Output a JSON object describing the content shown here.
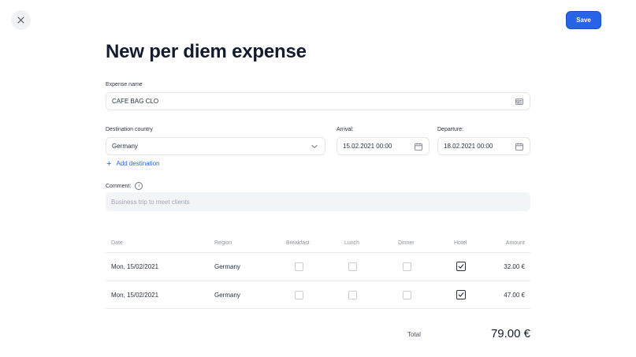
{
  "header": {
    "close_icon": "close-icon",
    "save_label": "Save"
  },
  "title": "New per diem expense",
  "expense_name": {
    "label": "Expense name",
    "value": "CAFE BAG CLO",
    "icon": "id-card-icon"
  },
  "destination": {
    "label": "Destination country",
    "value": "Germany",
    "icon": "chevron-down-icon"
  },
  "arrival": {
    "label": "Arrival:",
    "value": "15.02.2021 00:00",
    "icon": "calendar-icon"
  },
  "departure": {
    "label": "Departure:",
    "value": "18.02.2021 00:00",
    "icon": "calendar-icon"
  },
  "add_destination": {
    "plus": "+",
    "label": "Add destination"
  },
  "comment": {
    "label": "Comment:",
    "info": "i",
    "placeholder": "Business trip to meet clients"
  },
  "table": {
    "columns": [
      "Date",
      "Region",
      "Breakfast",
      "Lunch",
      "Dinner",
      "Hotel",
      "Amount"
    ],
    "rows": [
      {
        "date": "Mon, 15/02/2021",
        "region": "Germany",
        "breakfast": false,
        "lunch": false,
        "dinner": false,
        "hotel": true,
        "amount": "32.00 €"
      },
      {
        "date": "Mon, 15/02/2021",
        "region": "Germany",
        "breakfast": false,
        "lunch": false,
        "dinner": false,
        "hotel": true,
        "amount": "47.00 €"
      }
    ]
  },
  "total": {
    "label": "Total",
    "value": "79.00 €"
  },
  "colors": {
    "accent": "#2864e6",
    "text": "#131b2e",
    "muted": "#8d929c",
    "comment_bg": "#f2f4f5"
  }
}
